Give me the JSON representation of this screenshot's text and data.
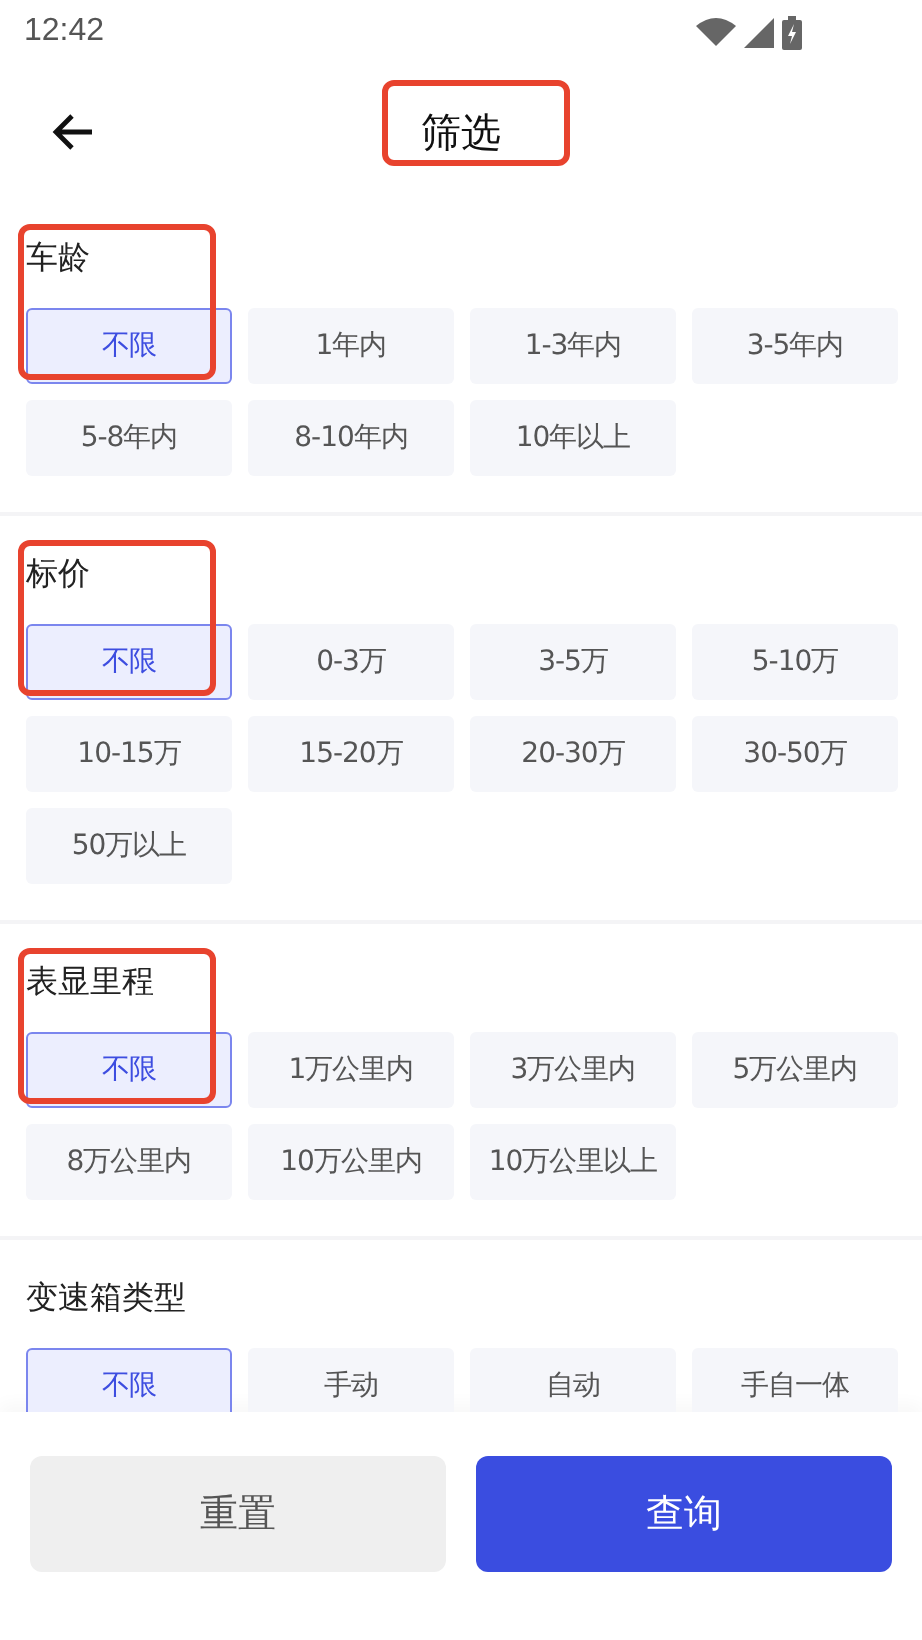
{
  "status_bar": {
    "time": "12:42"
  },
  "header": {
    "title": "筛选",
    "highlighted": true
  },
  "sections": [
    {
      "title": "车龄",
      "highlighted": true,
      "options": [
        {
          "label": "不限",
          "selected": true
        },
        {
          "label": "1年内",
          "selected": false
        },
        {
          "label": "1-3年内",
          "selected": false
        },
        {
          "label": "3-5年内",
          "selected": false
        },
        {
          "label": "5-8年内",
          "selected": false
        },
        {
          "label": "8-10年内",
          "selected": false
        },
        {
          "label": "10年以上",
          "selected": false
        }
      ]
    },
    {
      "title": "标价",
      "highlighted": true,
      "options": [
        {
          "label": "不限",
          "selected": true
        },
        {
          "label": "0-3万",
          "selected": false
        },
        {
          "label": "3-5万",
          "selected": false
        },
        {
          "label": "5-10万",
          "selected": false
        },
        {
          "label": "10-15万",
          "selected": false
        },
        {
          "label": "15-20万",
          "selected": false
        },
        {
          "label": "20-30万",
          "selected": false
        },
        {
          "label": "30-50万",
          "selected": false
        },
        {
          "label": "50万以上",
          "selected": false
        }
      ]
    },
    {
      "title": "表显里程",
      "highlighted": true,
      "options": [
        {
          "label": "不限",
          "selected": true
        },
        {
          "label": "1万公里内",
          "selected": false
        },
        {
          "label": "3万公里内",
          "selected": false
        },
        {
          "label": "5万公里内",
          "selected": false
        },
        {
          "label": "8万公里内",
          "selected": false
        },
        {
          "label": "10万公里内",
          "selected": false
        },
        {
          "label": "10万公里以上",
          "selected": false
        }
      ]
    },
    {
      "title": "变速箱类型",
      "highlighted": false,
      "options": [
        {
          "label": "不限",
          "selected": true
        },
        {
          "label": "手动",
          "selected": false
        },
        {
          "label": "自动",
          "selected": false
        },
        {
          "label": "手自一体",
          "selected": false
        }
      ]
    }
  ],
  "buttons": [
    {
      "label": "重置",
      "kind": "secondary"
    },
    {
      "label": "查询",
      "kind": "primary"
    }
  ]
}
